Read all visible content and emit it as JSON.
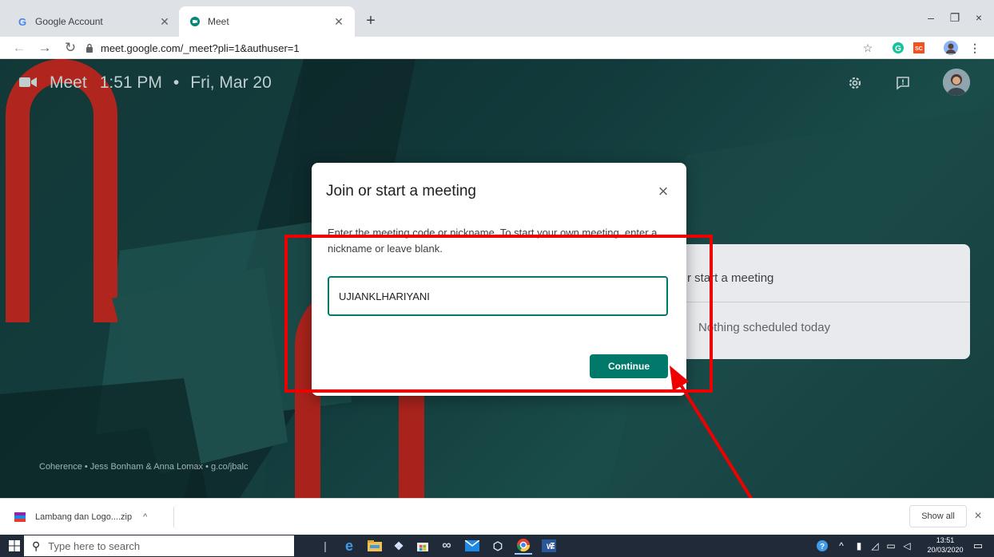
{
  "browser": {
    "tabs": [
      {
        "title": "Google Account",
        "favicon": "G",
        "active": false
      },
      {
        "title": "Meet",
        "favicon": "meet-icon",
        "active": true
      }
    ],
    "new_tab_symbol": "+",
    "window_controls": {
      "minimize": "–",
      "restore": "❐",
      "close": "×"
    },
    "url": "meet.google.com/_meet?pli=1&authuser=1",
    "toolbar_icons": [
      "star-icon",
      "grammarly-icon",
      "sc-extension-icon",
      "profile-avatar",
      "menu-dots-icon"
    ]
  },
  "meet": {
    "app_name": "Meet",
    "time": "1:51 PM",
    "separator": "•",
    "date": "Fri, Mar 20",
    "credit": "Coherence  •  Jess Bonham & Anna Lomax  •  g.co/jbalc",
    "side_card": {
      "start_text": "r start a meeting",
      "schedule_text": "Nothing scheduled today"
    }
  },
  "dialog": {
    "title": "Join or start a meeting",
    "close_symbol": "×",
    "description": "Enter the meeting code or nickname. To start your own meeting, enter a nickname or leave blank.",
    "input_value": "UJIANKLHARIYANI",
    "continue_label": "Continue"
  },
  "annotation": {
    "color": "#ee0000"
  },
  "download_bar": {
    "file_name": "Lambang dan Logo....zip",
    "chevron": "^",
    "show_all_label": "Show all",
    "close_symbol": "×"
  },
  "taskbar": {
    "search_placeholder": "Type here to search",
    "clock_time": "13:51",
    "clock_date": "20/03/2020"
  },
  "colors": {
    "meet_teal": "#00796b",
    "dialog_bg": "#ffffff",
    "taskbar_bg": "#202a38"
  }
}
